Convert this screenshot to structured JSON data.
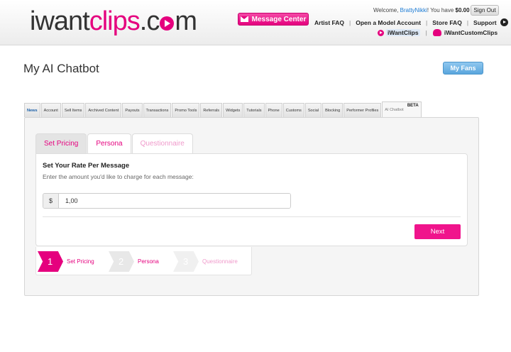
{
  "header": {
    "logo": {
      "i": "i",
      "want": "want",
      "clips": "clips",
      "dotcom": "c",
      "dotcom_tail": "m"
    },
    "message_center": "Message Center",
    "welcome_prefix": "Welcome,",
    "username": "BrattyNikki",
    "balance_text": "! You have",
    "balance": "$0.00",
    "sign_out": "Sign Out",
    "nav": [
      "Artist FAQ",
      "Open a Model Account",
      "Store FAQ",
      "Support"
    ],
    "sites": [
      "iWantClips",
      "iWantCustomClips"
    ]
  },
  "page": {
    "title": "My AI Chatbot",
    "fans_button": "My Fans"
  },
  "tabs": [
    "News",
    "Account",
    "Sell Items",
    "Archived Content",
    "Payouts",
    "Transactions",
    "Promo Tools",
    "Referrals",
    "Widgets",
    "Tutorials",
    "Phone",
    "Customs",
    "Social",
    "Blocking",
    "Performer Profiles",
    "AI Chatbot"
  ],
  "beta_label": "BETA",
  "subtabs": [
    "Set Pricing",
    "Persona",
    "Questionnaire"
  ],
  "form": {
    "title": "Set Your Rate Per Message",
    "description": "Enter the amount you'd like to charge for each message:",
    "currency": "$",
    "rate_value": "1,00",
    "next": "Next"
  },
  "steps": [
    {
      "num": "1",
      "label": "Set Pricing"
    },
    {
      "num": "2",
      "label": "Persona"
    },
    {
      "num": "3",
      "label": "Questionnaire"
    }
  ],
  "colors": {
    "brand_pink": "#e5007e",
    "next_button": "#f0148c",
    "my_fans_button": "#5aa6dd",
    "step1_bg": "#e5007e",
    "step_inactive_bg": "#e8e8e8"
  }
}
